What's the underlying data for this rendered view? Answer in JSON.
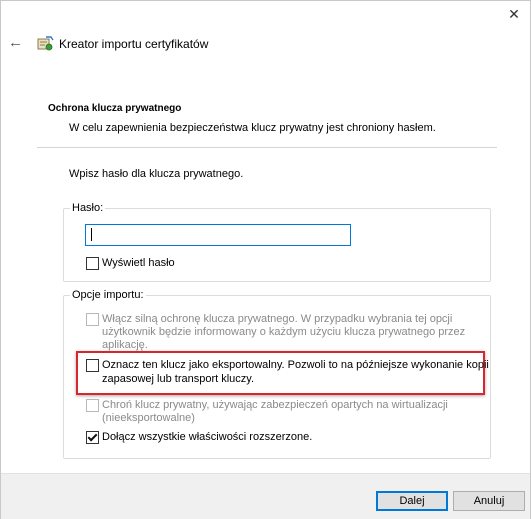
{
  "window": {
    "close_glyph": "✕",
    "back_glyph": "←",
    "title": "Kreator importu certyfikatów",
    "icon": "certificate-wizard-icon"
  },
  "section": {
    "title": "Ochrona klucza prywatnego",
    "description": "W celu zapewnienia bezpieczeństwa klucz prywatny jest chroniony hasłem."
  },
  "prompt": "Wpisz hasło dla klucza prywatnego.",
  "password_group": {
    "legend": "Hasło:",
    "input_value": "",
    "show_password_label": "Wyświetl hasło",
    "show_password_checked": false
  },
  "options_group": {
    "legend": "Opcje importu:",
    "strong_protection": {
      "line1": "Włącz silną ochronę klucza prywatnego. W przypadku wybrania tej opcji",
      "line2": "użytkownik będzie informowany o każdym użyciu klucza prywatnego przez",
      "line3": "aplikację.",
      "checked": false,
      "enabled": false
    },
    "exportable": {
      "line1": "Oznacz ten klucz jako eksportowalny. Pozwoli to na późniejsze wykonanie kopii",
      "line2": "zapasowej lub transport kluczy.",
      "checked": false,
      "enabled": true,
      "highlight_color": "#d9262c"
    },
    "virtualization": {
      "line1": "Chroń klucz prywatny, używając zabezpieczeń opartych na wirtualizacji",
      "line2": "(nieeksportowalne)",
      "checked": false,
      "enabled": false
    },
    "extended_props": {
      "label": "Dołącz wszystkie właściwości rozszerzone.",
      "checked": true,
      "enabled": true
    }
  },
  "buttons": {
    "next": "Dalej",
    "cancel": "Anuluj"
  },
  "colors": {
    "accent": "#0078d7",
    "footer_bg": "#f0f0f0",
    "disabled_text": "#8a8a8a"
  }
}
